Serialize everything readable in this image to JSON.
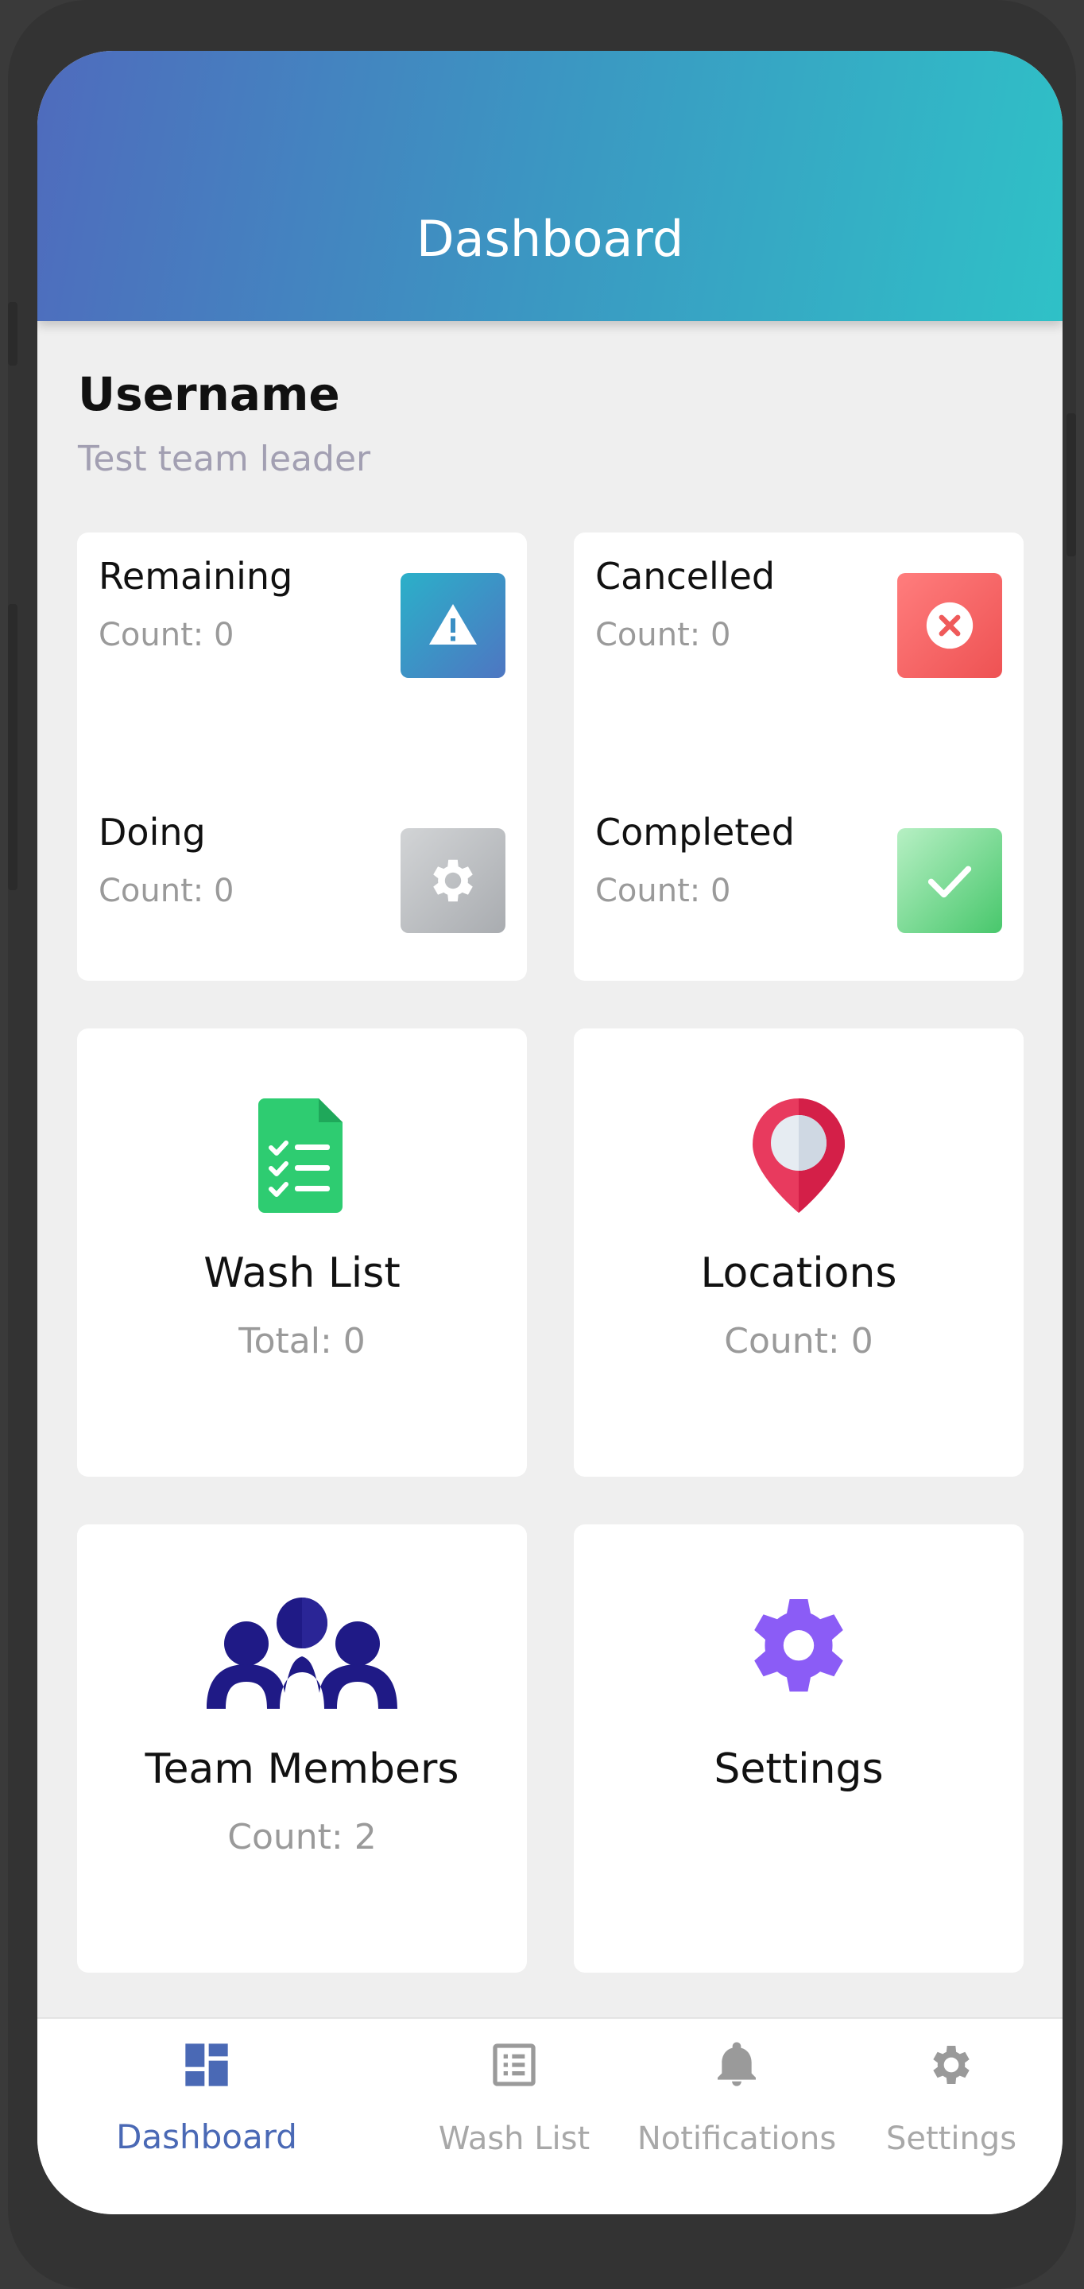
{
  "header": {
    "title": "Dashboard"
  },
  "user": {
    "name": "Username",
    "role": "Test team leader"
  },
  "stats": {
    "remaining": {
      "title": "Remaining",
      "count": "Count: 0",
      "icon": "warning-icon",
      "color": "#3a9ac6"
    },
    "cancelled": {
      "title": "Cancelled",
      "count": "Count: 0",
      "icon": "close-circle-icon",
      "color": "#f06464"
    },
    "doing": {
      "title": "Doing",
      "count": "Count: 0",
      "icon": "gear-icon",
      "color": "#b8babd"
    },
    "completed": {
      "title": "Completed",
      "count": "Count: 0",
      "icon": "checkmark-icon",
      "color": "#6fd68b"
    }
  },
  "tiles": {
    "wash_list": {
      "label": "Wash List",
      "sub": "Total: 0",
      "icon": "checklist-document-icon",
      "color": "#2ecc71"
    },
    "locations": {
      "label": "Locations",
      "sub": "Count: 0",
      "icon": "map-pin-icon",
      "color": "#e83a5e"
    },
    "team_members": {
      "label": "Team Members",
      "sub": "Count: 2",
      "icon": "team-members-icon",
      "color": "#1f1a86"
    },
    "settings": {
      "label": "Settings",
      "icon": "settings-gear-icon",
      "color": "#8b5cf6"
    }
  },
  "nav": {
    "dashboard": {
      "label": "Dashboard",
      "icon": "dashboard-icon",
      "active": true
    },
    "wash_list": {
      "label": "Wash List",
      "icon": "list-icon"
    },
    "notifications": {
      "label": "Notifications",
      "icon": "bell-icon"
    },
    "settings": {
      "label": "Settings",
      "icon": "gear-icon"
    }
  },
  "colors": {
    "accent": "#4a69b5",
    "header_start": "#4f6bbd",
    "header_end": "#2fc1c7"
  }
}
